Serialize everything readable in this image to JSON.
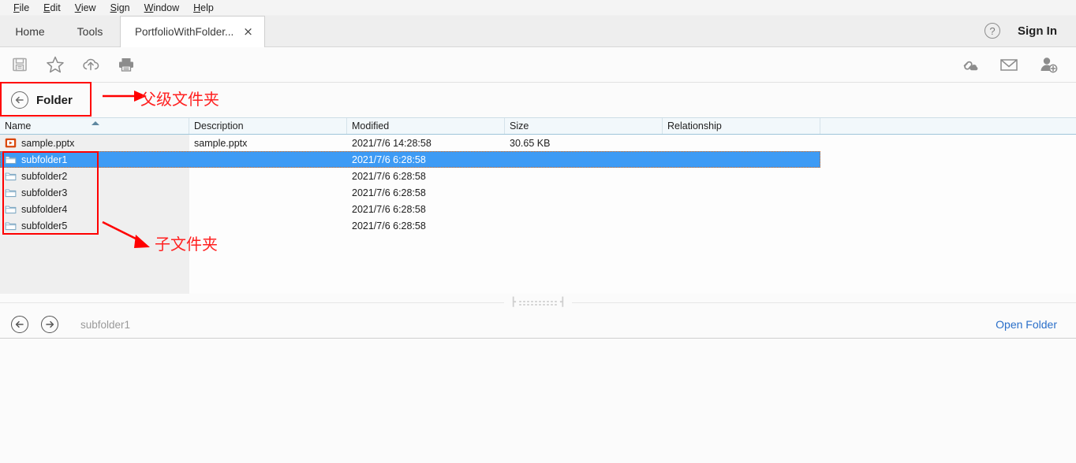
{
  "menubar": {
    "items": [
      {
        "mnemonic": "F",
        "rest": "ile"
      },
      {
        "mnemonic": "E",
        "rest": "dit"
      },
      {
        "mnemonic": "V",
        "rest": "iew"
      },
      {
        "mnemonic": "S",
        "rest": "ign"
      },
      {
        "mnemonic": "W",
        "rest": "indow"
      },
      {
        "mnemonic": "H",
        "rest": "elp"
      }
    ]
  },
  "tabs": {
    "home": "Home",
    "tools": "Tools",
    "document": "PortfolioWithFolder...",
    "close": "×",
    "help_icon": "help-circle-icon",
    "sign_in": "Sign In"
  },
  "toolbar": {
    "left_icons": [
      "save-icon",
      "star-icon",
      "cloud-upload-icon",
      "print-icon"
    ],
    "right_icons": [
      "share-link-icon",
      "email-icon",
      "add-person-icon"
    ]
  },
  "folder_header": {
    "back_icon": "back-arrow-circle-icon",
    "title": "Folder"
  },
  "annotations": {
    "parent_folder_text": "父级文件夹",
    "subfolder_text": "子文件夹",
    "color": "#ff2020"
  },
  "file_list": {
    "columns": [
      {
        "key": "name",
        "label": "Name",
        "sorted": "asc"
      },
      {
        "key": "description",
        "label": "Description"
      },
      {
        "key": "modified",
        "label": "Modified"
      },
      {
        "key": "size",
        "label": "Size"
      },
      {
        "key": "relationship",
        "label": "Relationship"
      }
    ],
    "rows": [
      {
        "icon": "pptx-file-icon",
        "name": "sample.pptx",
        "description": "sample.pptx",
        "modified": "2021/7/6 14:28:58",
        "size": "30.65 KB",
        "relationship": "",
        "selected": false
      },
      {
        "icon": "folder-icon",
        "name": "subfolder1",
        "description": "",
        "modified": "2021/7/6 6:28:58",
        "size": "",
        "relationship": "",
        "selected": true
      },
      {
        "icon": "folder-icon",
        "name": "subfolder2",
        "description": "",
        "modified": "2021/7/6 6:28:58",
        "size": "",
        "relationship": "",
        "selected": false
      },
      {
        "icon": "folder-icon",
        "name": "subfolder3",
        "description": "",
        "modified": "2021/7/6 6:28:58",
        "size": "",
        "relationship": "",
        "selected": false
      },
      {
        "icon": "folder-icon",
        "name": "subfolder4",
        "description": "",
        "modified": "2021/7/6 6:28:58",
        "size": "",
        "relationship": "",
        "selected": false
      },
      {
        "icon": "folder-icon",
        "name": "subfolder5",
        "description": "",
        "modified": "2021/7/6 6:28:58",
        "size": "",
        "relationship": "",
        "selected": false
      }
    ]
  },
  "bottombar": {
    "back_icon": "back-arrow-circle-icon",
    "forward_icon": "forward-arrow-circle-icon",
    "breadcrumb": "subfolder1",
    "open_folder": "Open Folder"
  },
  "colors": {
    "selection": "#3d9bf5",
    "link": "#2a6fc9",
    "annotation": "#ff0000",
    "pptx_icon": "#d9470b"
  }
}
